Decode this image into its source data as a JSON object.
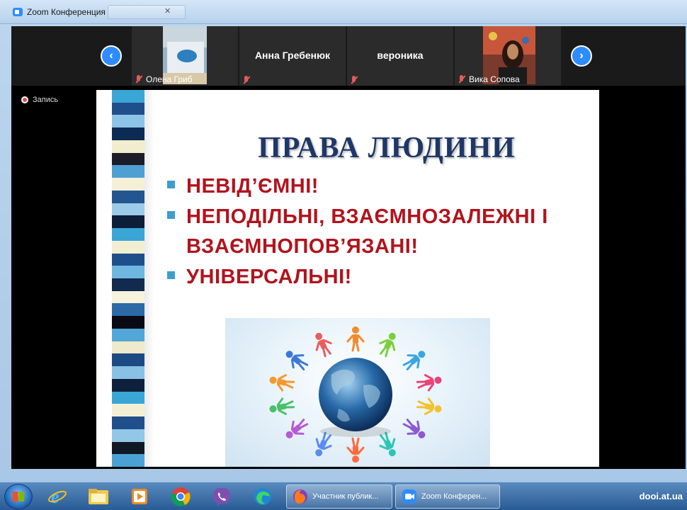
{
  "window": {
    "title": "Zoom Конференция"
  },
  "participants": [
    {
      "name": "Олена Гриб",
      "has_video": true,
      "muted": true
    },
    {
      "name": "Анна Гребенюк",
      "has_video": false,
      "muted": true
    },
    {
      "name": "вероника",
      "has_video": false,
      "muted": true
    },
    {
      "name": "Вика Сопова",
      "has_video": true,
      "muted": true
    }
  ],
  "recording": {
    "label": "Запись"
  },
  "slide": {
    "title": "ПРАВА ЛЮДИНИ",
    "bullets": [
      "НЕВІД’ЄМНІ!",
      "НЕПОДІЛЬНІ, ВЗАЄМНОЗАЛЕЖНІ І ВЗАЄМНОПОВ’ЯЗАНІ!",
      "УНІВЕРСАЛЬНІ!"
    ],
    "colors": {
      "title": "#1f3766",
      "bullet_text": "#b0141d",
      "bullet_marker": "#3e9ccf"
    }
  },
  "taskbar": {
    "tasks": [
      {
        "label": "Участник публик...",
        "icon": "firefox-icon"
      },
      {
        "label": "Zoom Конферен...",
        "icon": "zoom-icon"
      }
    ],
    "pinned": [
      "ie-icon",
      "folder-icon",
      "media-player-icon",
      "chrome-icon",
      "viber-icon",
      "edge-icon"
    ],
    "watermark": "dooi.at.ua"
  },
  "colors": {
    "zoom_accent": "#2d8cff",
    "mute_red": "#e25c5c"
  }
}
